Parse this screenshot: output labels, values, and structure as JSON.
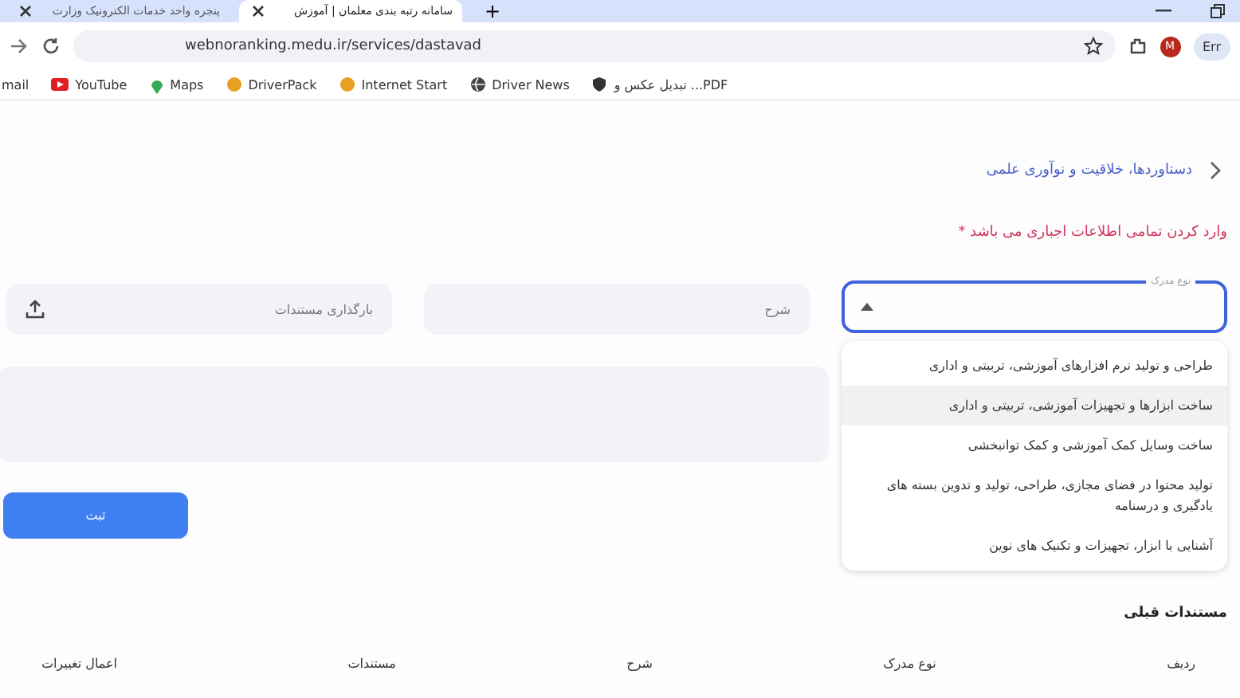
{
  "browser": {
    "tabs": [
      {
        "title": "سامانه رتبه بندی معلمان | آموزش",
        "selected": true
      },
      {
        "title": "پنجره واحد خدمات الکترونیک وزارت",
        "selected": false
      }
    ],
    "new_tab": "+",
    "address": "webnoranking.medu.ir/services/dastavad",
    "profile": "M",
    "profile_button": "Err",
    "bookmarks": [
      {
        "label": "تبدیل عکس و ...PDF",
        "kind": "shield"
      },
      {
        "label": "Driver News",
        "kind": "globe"
      },
      {
        "label": "Internet Start",
        "kind": "app"
      },
      {
        "label": "DriverPack",
        "kind": "app"
      },
      {
        "label": "Maps",
        "kind": "maps"
      },
      {
        "label": "YouTube",
        "kind": "youtube"
      },
      {
        "label": "mail",
        "kind": "text"
      }
    ]
  },
  "page": {
    "breadcrumb": "دستاوردها، خلاقیت و نوآوری علمی",
    "required_note": "وارد کردن تمامی اطلاعات اجباری می باشد *",
    "type_field": {
      "label": "نوع مدرک",
      "expanded": true
    },
    "options": [
      {
        "text": "طراحی و تولید نرم افزارهای آموزشی، تربیتی و اداری",
        "selected": false
      },
      {
        "text": "ساخت ابزارها و تجهیزات آموزشی، تربیتی و اداری",
        "selected": true
      },
      {
        "text": "ساخت وسایل کمک آموزشی و کمک توانبخشی",
        "selected": false
      },
      {
        "text": "تولید محتوا در فضای مجازی، طراحی، تولید و تدوین بسته های یادگیری و درسنامه",
        "selected": false
      },
      {
        "text": "آشنایی با ابزار، تجهیزات و تکنیک های نوین",
        "selected": false
      }
    ],
    "description_placeholder": "شرح",
    "upload_placeholder": "بارگذاری مستندات",
    "submit": "ثبت",
    "previous_title": "مستندات قبلی",
    "table": {
      "columns": [
        "ردیف",
        "نوع مدرک",
        "شرح",
        "مستندات",
        "اعمال تغییرات"
      ]
    }
  }
}
